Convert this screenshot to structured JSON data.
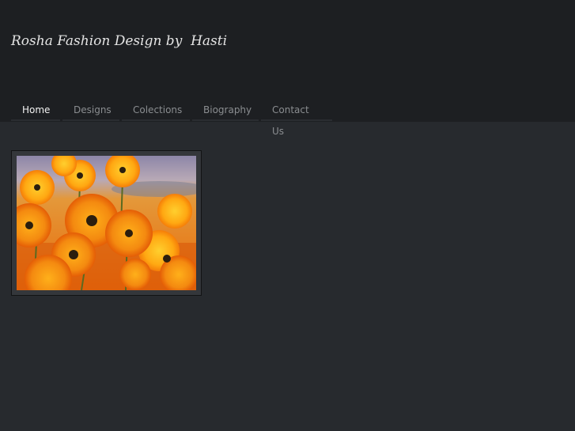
{
  "site": {
    "title": "Rosha Fashion Design by  Hasti"
  },
  "nav": {
    "items": [
      {
        "label": "Home",
        "active": true
      },
      {
        "label": "Designs",
        "active": false
      },
      {
        "label": "Colections",
        "active": false
      },
      {
        "label": "Biography",
        "active": false
      },
      {
        "label": "Contact Us",
        "active": false
      }
    ]
  },
  "colors": {
    "header_bg": "#1d1f22",
    "page_bg": "#272a2e",
    "nav_active": "#f2f2f2",
    "nav_inactive": "#8a8d90",
    "flower_orange": "#f07a12"
  },
  "main": {
    "image_subject": "orange-daisy-photo"
  }
}
